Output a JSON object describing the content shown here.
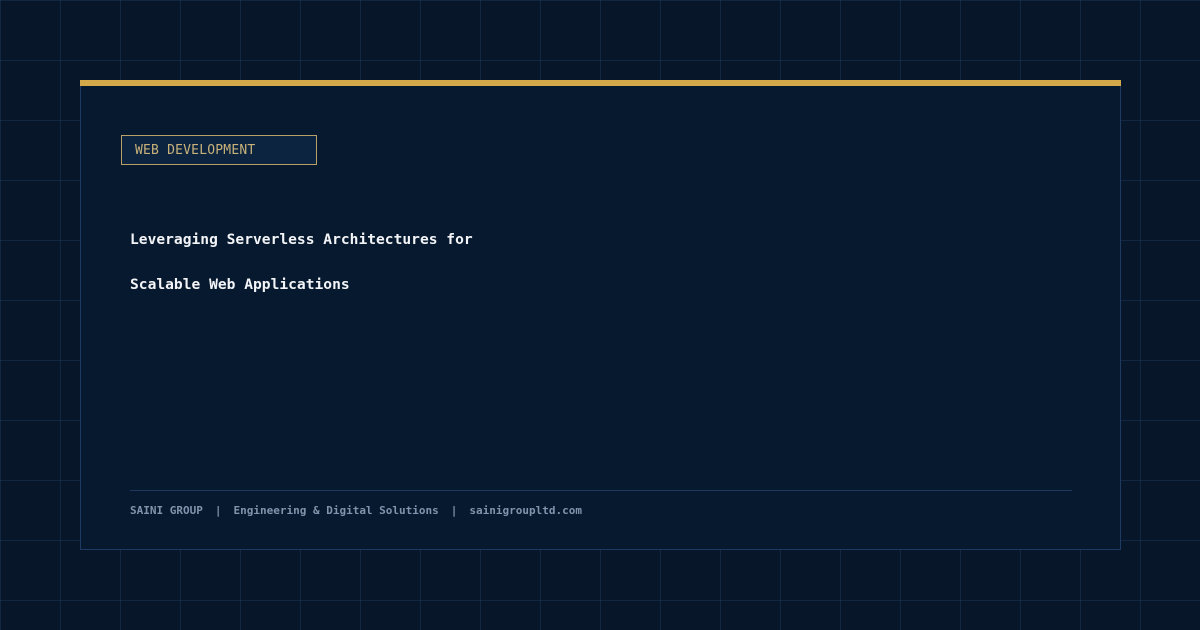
{
  "badge": {
    "label": "WEB DEVELOPMENT"
  },
  "title": {
    "line1": "Leveraging Serverless Architectures for",
    "line2": "Scalable Web Applications"
  },
  "footer": {
    "company": "SAINI GROUP",
    "separator": "|",
    "tagline": "Engineering & Digital Solutions",
    "website": "sainigroupltd.com"
  },
  "colors": {
    "background": "#071629",
    "card": "#07192e",
    "accent": "#d4a94a",
    "title_text": "#f2f4f7",
    "footer_text": "#8294ad"
  }
}
